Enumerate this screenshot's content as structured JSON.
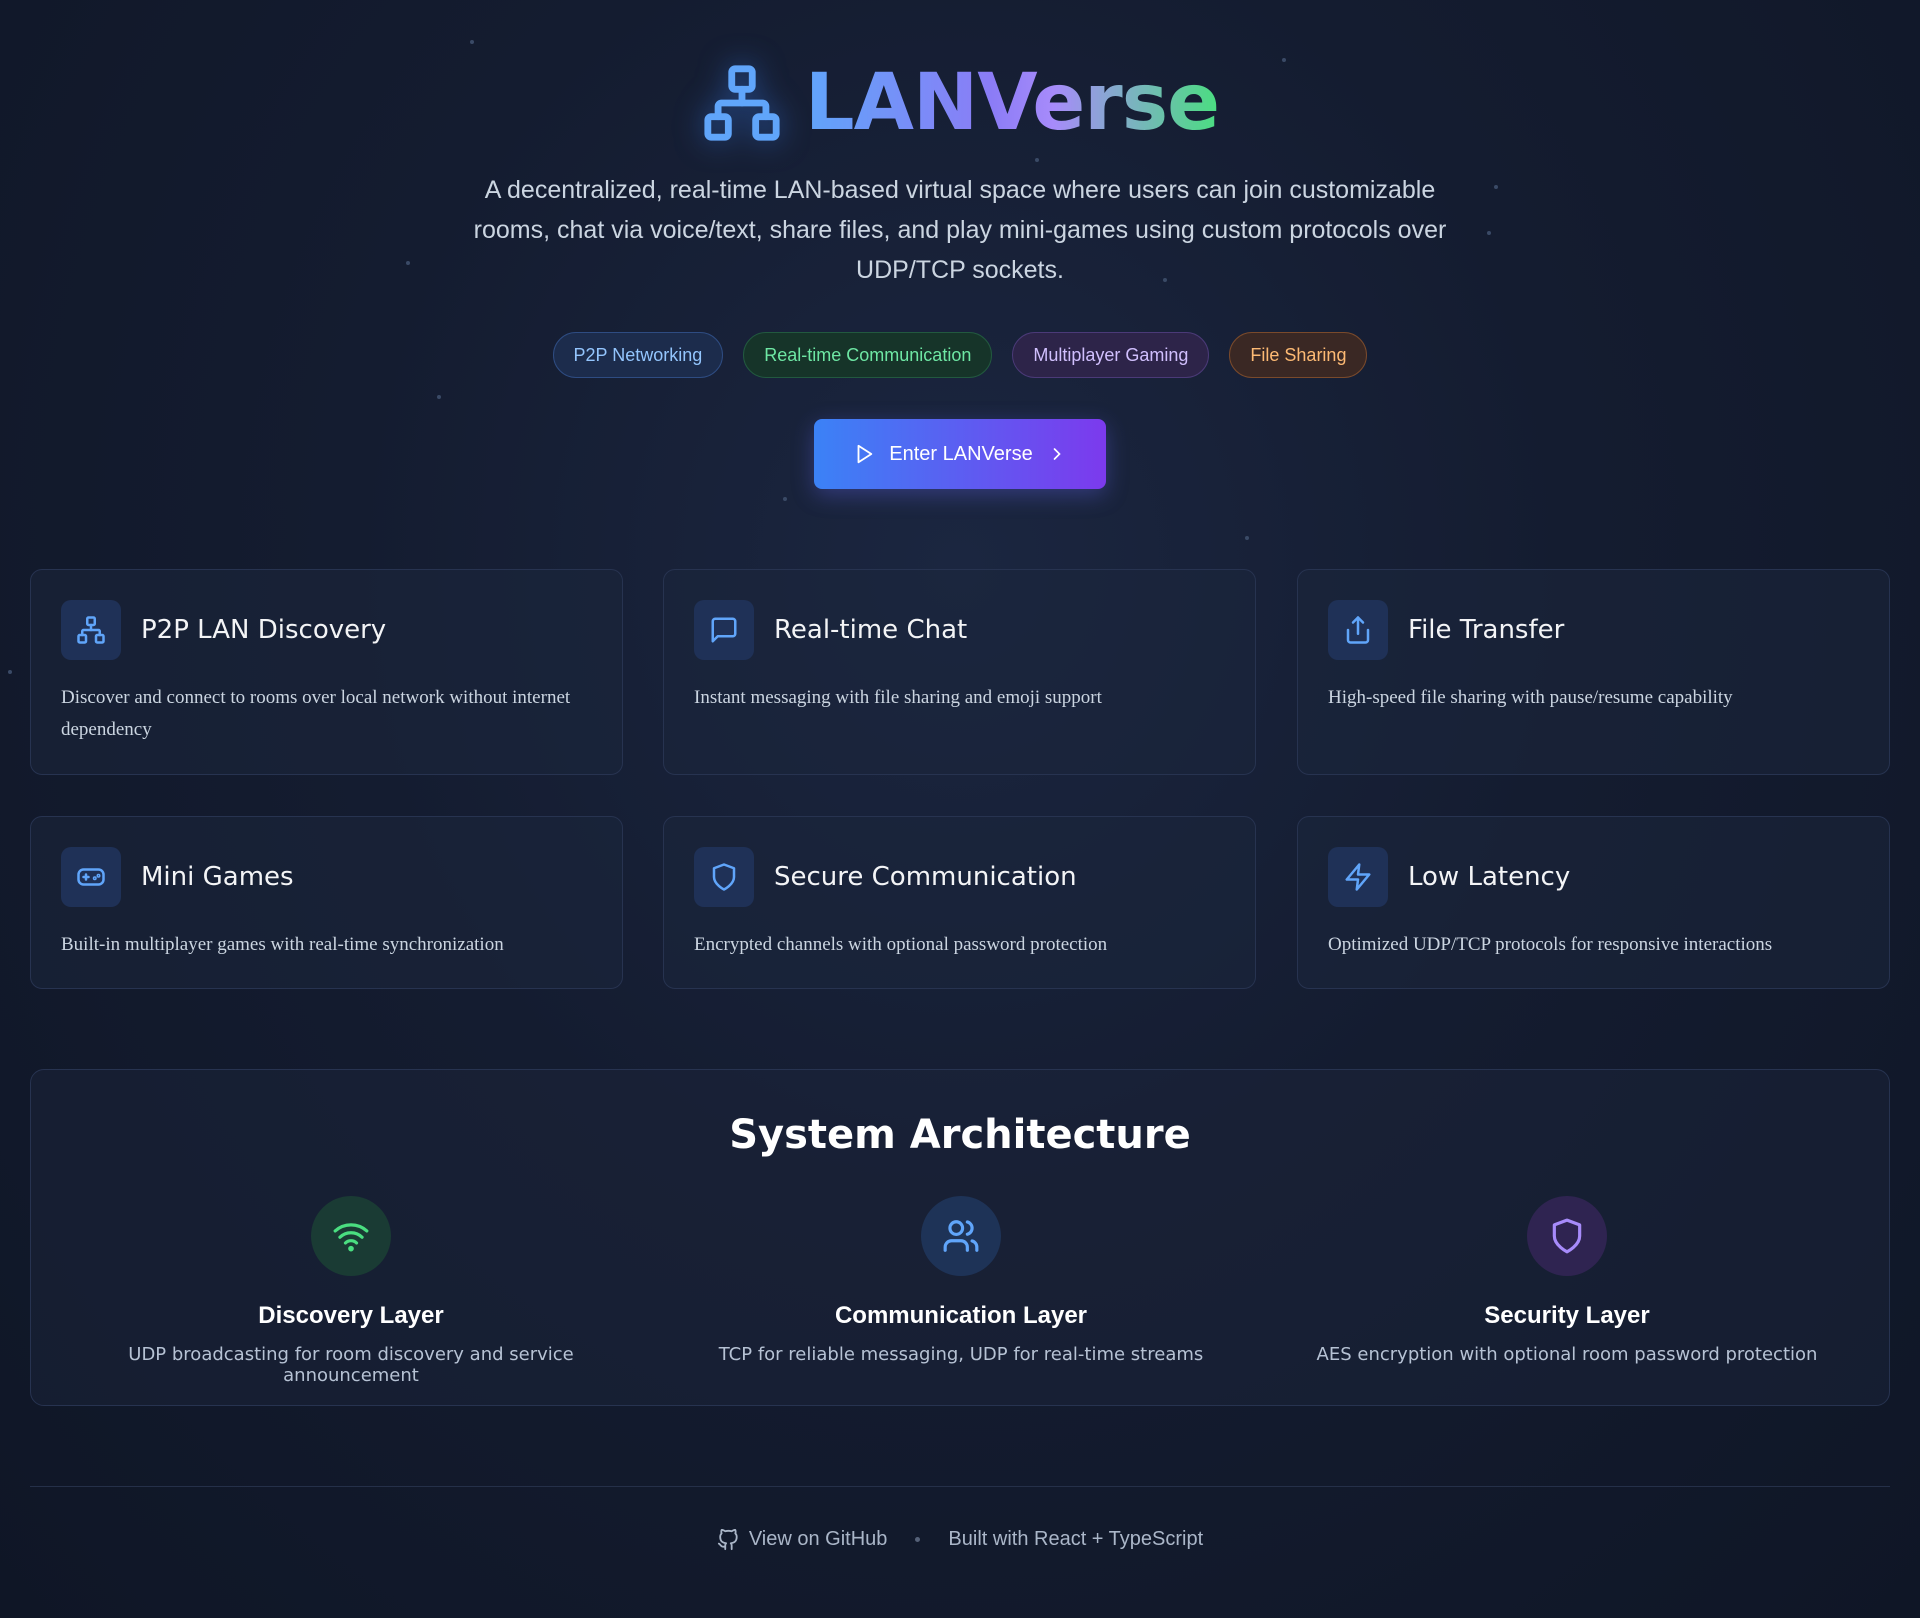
{
  "brand": {
    "name": "LANVerse",
    "logo_icon": "network-icon"
  },
  "tagline": "A decentralized, real-time LAN-based virtual space where users can join customizable rooms, chat via voice/text, share files, and play mini-games using custom protocols over UDP/TCP sockets.",
  "tags": [
    {
      "label": "P2P Networking",
      "color": "#93c5fd"
    },
    {
      "label": "Real-time Communication",
      "color": "#6ee7a4"
    },
    {
      "label": "Multiplayer Gaming",
      "color": "#d0bffd"
    },
    {
      "label": "File Sharing",
      "color": "#fdba74"
    }
  ],
  "cta": {
    "label": "Enter LANVerse",
    "icon_left": "play-icon",
    "icon_right": "chevron-right-icon"
  },
  "features": [
    {
      "title": "P2P LAN Discovery",
      "description": "Discover and connect to rooms over local network without internet dependency",
      "icon": "network-icon"
    },
    {
      "title": "Real-time Chat",
      "description": "Instant messaging with file sharing and emoji support",
      "icon": "message-square-icon"
    },
    {
      "title": "File Transfer",
      "description": "High-speed file sharing with pause/resume capability",
      "icon": "upload-icon"
    },
    {
      "title": "Mini Games",
      "description": "Built-in multiplayer games with real-time synchronization",
      "icon": "gamepad-icon"
    },
    {
      "title": "Secure Communication",
      "description": "Encrypted channels with optional password protection",
      "icon": "shield-icon"
    },
    {
      "title": "Low Latency",
      "description": "Optimized UDP/TCP protocols for responsive interactions",
      "icon": "zap-icon"
    }
  ],
  "architecture": {
    "title": "System Architecture",
    "layers": [
      {
        "title": "Discovery Layer",
        "description": "UDP broadcasting for room discovery and service announcement",
        "icon": "wifi-icon",
        "accent": "#4ade80"
      },
      {
        "title": "Communication Layer",
        "description": "TCP for reliable messaging, UDP for real-time streams",
        "icon": "users-icon",
        "accent": "#60a5fa"
      },
      {
        "title": "Security Layer",
        "description": "AES encryption with optional room password protection",
        "icon": "shield-icon",
        "accent": "#a78bfa"
      }
    ]
  },
  "footer": {
    "github_label": "View on GitHub",
    "github_icon": "github-icon",
    "built_with": "Built with React + TypeScript"
  },
  "colors": {
    "accent_blue": "#3b82f6",
    "accent_purple": "#7c3aed",
    "background": "#141c30"
  }
}
